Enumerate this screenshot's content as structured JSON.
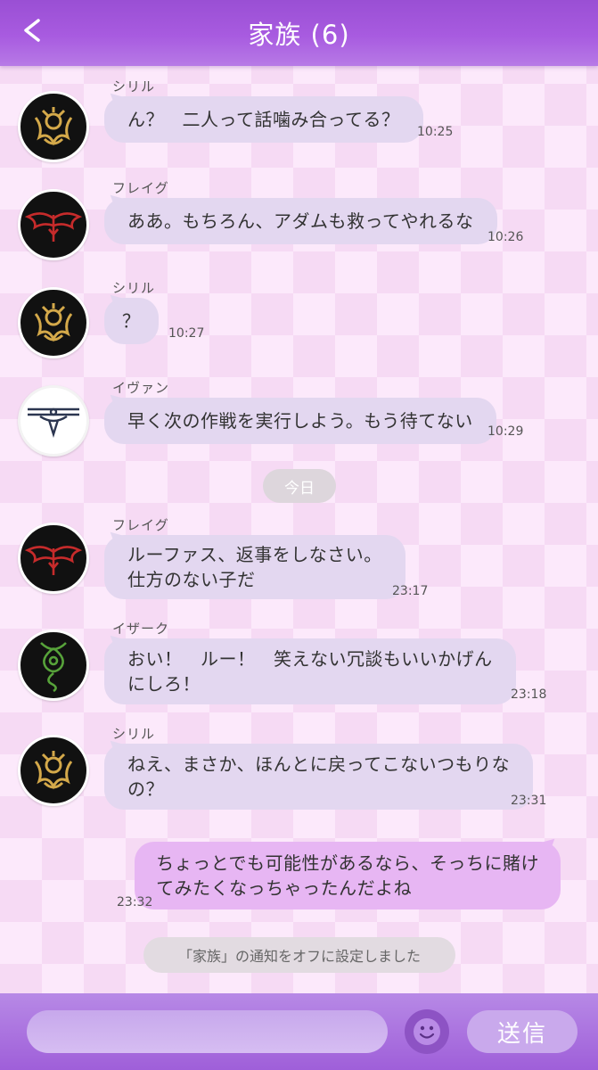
{
  "header": {
    "title": "家族 (6)",
    "back_icon": "chevron-left-icon"
  },
  "messages": [
    {
      "sender": "シリル",
      "avatar": "gold-crest-emblem",
      "lines": [
        "ん？　二人って話噛み合ってる？"
      ],
      "time": "10:25"
    },
    {
      "sender": "フレイグ",
      "avatar": "red-wings-emblem",
      "lines": [
        "ああ。もちろん、アダムも救ってやれるな"
      ],
      "time": "10:26"
    },
    {
      "sender": "シリル",
      "avatar": "gold-crest-emblem",
      "lines": [
        "？"
      ],
      "time": "10:27"
    },
    {
      "sender": "イヴァン",
      "avatar": "silver-choker-emblem",
      "lines": [
        "早く次の作戦を実行しよう。もう待てない"
      ],
      "time": "10:29"
    },
    {
      "sender": "フレイグ",
      "avatar": "red-wings-emblem",
      "lines": [
        "ルーファス、返事をしなさい。",
        "仕方のない子だ"
      ],
      "time": "23:17"
    },
    {
      "sender": "イザーク",
      "avatar": "green-serpent-emblem",
      "lines": [
        "おい！　ルー！　笑えない冗談もいいかげん",
        "にしろ！"
      ],
      "time": "23:18"
    },
    {
      "sender": "シリル",
      "avatar": "gold-crest-emblem",
      "lines": [
        "ねえ、まさか、ほんとに戻ってこないつもりな",
        "の？"
      ],
      "time": "23:31"
    }
  ],
  "date_divider": "今日",
  "my_message": {
    "lines": [
      "ちょっとでも可能性があるなら、そっちに賭け",
      "てみたくなっちゃったんだよね"
    ],
    "time": "23:32"
  },
  "system_notice": "「家族」の通知をオフに設定しました",
  "input": {
    "value": "",
    "placeholder": "",
    "emoji_icon": "smiley-icon",
    "send_label": "送信"
  },
  "colors": {
    "header": "#a85be0",
    "bubble_other": "#e3d7f0",
    "bubble_me": "#e7b6f3",
    "background": "#fce9fb"
  }
}
